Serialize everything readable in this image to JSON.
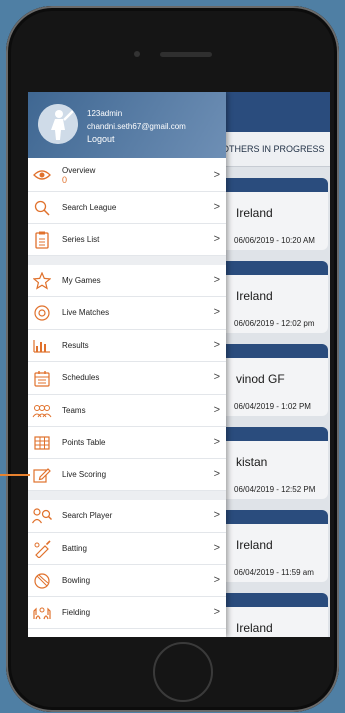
{
  "user": {
    "name": "123admin",
    "email": "chandni.seth67@gmail.com",
    "logout_label": "Logout"
  },
  "background": {
    "tab_label": "OTHERS IN PROGRESS",
    "cards": [
      {
        "title": "Ireland",
        "date": "06/06/2019 - 10:20 AM"
      },
      {
        "title": "Ireland",
        "date": "06/06/2019 - 12:02 pm"
      },
      {
        "title": "vinod GF",
        "date": "06/04/2019 - 1:02 PM"
      },
      {
        "title": "kistan",
        "date": "06/04/2019 - 12:52 PM"
      },
      {
        "title": "Ireland",
        "date": "06/04/2019 - 11:59 am"
      },
      {
        "title": "Ireland",
        "date": ""
      }
    ]
  },
  "menu": [
    {
      "label": "Overview",
      "sub": "0",
      "icon": "eye-icon"
    },
    {
      "label": "Search League",
      "icon": "search-icon"
    },
    {
      "label": "Series List",
      "icon": "clipboard-icon"
    },
    {
      "label": "My Games",
      "icon": "star-icon"
    },
    {
      "label": "Live Matches",
      "icon": "target-icon"
    },
    {
      "label": "Results",
      "icon": "bar-chart-icon"
    },
    {
      "label": "Schedules",
      "icon": "calendar-icon"
    },
    {
      "label": "Teams",
      "icon": "people-icon"
    },
    {
      "label": "Points Table",
      "icon": "grid-icon"
    },
    {
      "label": "Live Scoring",
      "icon": "edit-icon"
    },
    {
      "label": "Search Player",
      "icon": "user-search-icon"
    },
    {
      "label": "Batting",
      "icon": "cricket-bat-icon"
    },
    {
      "label": "Bowling",
      "icon": "ball-icon"
    },
    {
      "label": "Fielding",
      "icon": "hands-icon"
    }
  ],
  "colors": {
    "accent": "#e0712c",
    "header_blue": "#2a4c7d"
  }
}
